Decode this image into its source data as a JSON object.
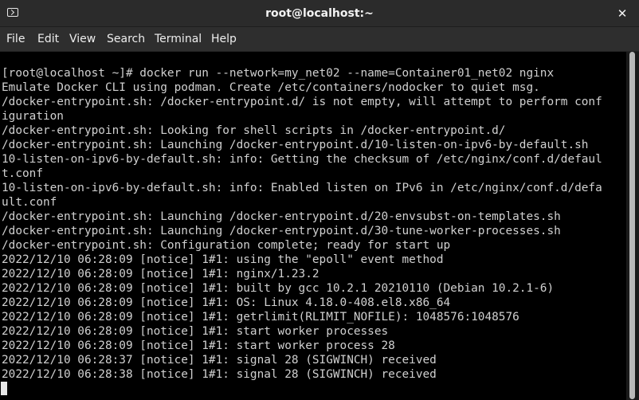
{
  "window": {
    "title": "root@localhost:~",
    "close_glyph": "✕"
  },
  "menu": [
    {
      "label": "File"
    },
    {
      "label": "Edit"
    },
    {
      "label": "View"
    },
    {
      "label": "Search"
    },
    {
      "label": "Terminal"
    },
    {
      "label": "Help"
    }
  ],
  "terminal": {
    "lines": [
      "[root@localhost ~]# docker run --network=my_net02 --name=Container01_net02 nginx",
      "Emulate Docker CLI using podman. Create /etc/containers/nodocker to quiet msg.",
      "/docker-entrypoint.sh: /docker-entrypoint.d/ is not empty, will attempt to perform conf",
      "iguration",
      "/docker-entrypoint.sh: Looking for shell scripts in /docker-entrypoint.d/",
      "/docker-entrypoint.sh: Launching /docker-entrypoint.d/10-listen-on-ipv6-by-default.sh",
      "10-listen-on-ipv6-by-default.sh: info: Getting the checksum of /etc/nginx/conf.d/defaul",
      "t.conf",
      "10-listen-on-ipv6-by-default.sh: info: Enabled listen on IPv6 in /etc/nginx/conf.d/defa",
      "ult.conf",
      "/docker-entrypoint.sh: Launching /docker-entrypoint.d/20-envsubst-on-templates.sh",
      "/docker-entrypoint.sh: Launching /docker-entrypoint.d/30-tune-worker-processes.sh",
      "/docker-entrypoint.sh: Configuration complete; ready for start up",
      "2022/12/10 06:28:09 [notice] 1#1: using the \"epoll\" event method",
      "2022/12/10 06:28:09 [notice] 1#1: nginx/1.23.2",
      "2022/12/10 06:28:09 [notice] 1#1: built by gcc 10.2.1 20210110 (Debian 10.2.1-6)",
      "2022/12/10 06:28:09 [notice] 1#1: OS: Linux 4.18.0-408.el8.x86_64",
      "2022/12/10 06:28:09 [notice] 1#1: getrlimit(RLIMIT_NOFILE): 1048576:1048576",
      "2022/12/10 06:28:09 [notice] 1#1: start worker processes",
      "2022/12/10 06:28:09 [notice] 1#1: start worker process 28",
      "2022/12/10 06:28:37 [notice] 1#1: signal 28 (SIGWINCH) received",
      "2022/12/10 06:28:38 [notice] 1#1: signal 28 (SIGWINCH) received"
    ]
  },
  "colors": {
    "terminal_bg": "#000000",
    "terminal_fg": "#d0d0d0",
    "titlebar_bg": "#2b2b2b",
    "menubar_bg": "#2e2e2e"
  }
}
